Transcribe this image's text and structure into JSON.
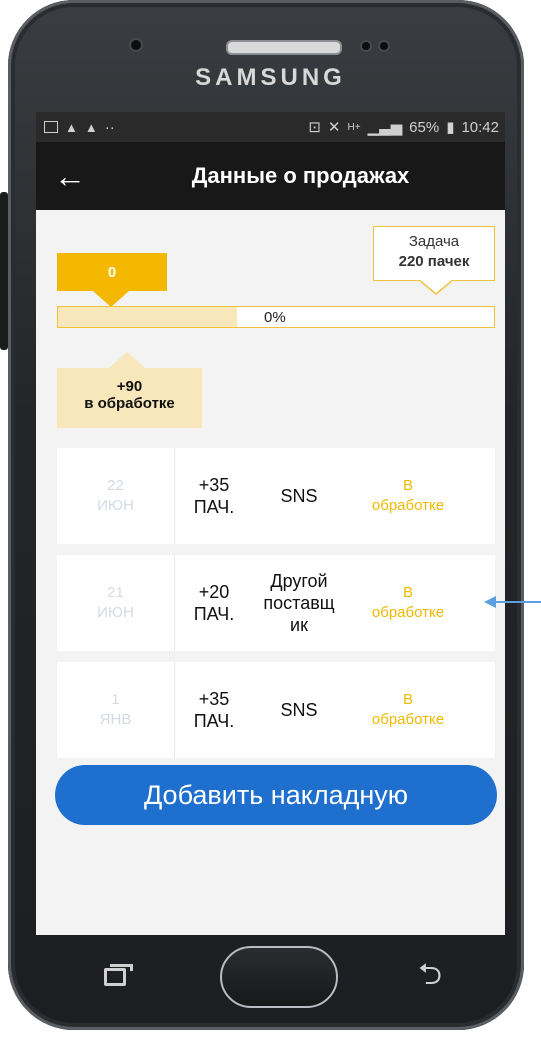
{
  "device": {
    "brand": "SAMSUNG"
  },
  "status_bar": {
    "battery": "65%",
    "time": "10:42",
    "network": "H+"
  },
  "app_bar": {
    "title": "Данные о продажах"
  },
  "progress": {
    "current_value": "0",
    "goal_label": "Задача",
    "goal_value": "220 пачек",
    "percent_text": "0%",
    "fill_fraction": 0.41,
    "pending_value": "+90",
    "pending_label": "в обработке"
  },
  "sales": [
    {
      "day": "22",
      "month": "ИЮН",
      "amount": "+35",
      "unit": "ПАЧ.",
      "supplier": "SNS",
      "status_line1": "В",
      "status_line2": "обработке"
    },
    {
      "day": "21",
      "month": "ИЮН",
      "amount": "+20",
      "unit": "ПАЧ.",
      "supplier_line1": "Другой",
      "supplier_line2": "поставщ",
      "supplier_line3": "ик",
      "status_line1": "В",
      "status_line2": "обработке"
    },
    {
      "day": "1",
      "month": "ЯНВ",
      "amount": "+35",
      "unit": "ПАЧ.",
      "supplier": "SNS",
      "status_line1": "В",
      "status_line2": "обработке"
    }
  ],
  "add_button": {
    "label": "Добавить накладную"
  },
  "colors": {
    "accent": "#f5b800",
    "primary_button": "#1e6fce",
    "app_bar": "#181818",
    "pending_bg": "#f8e7bb"
  }
}
